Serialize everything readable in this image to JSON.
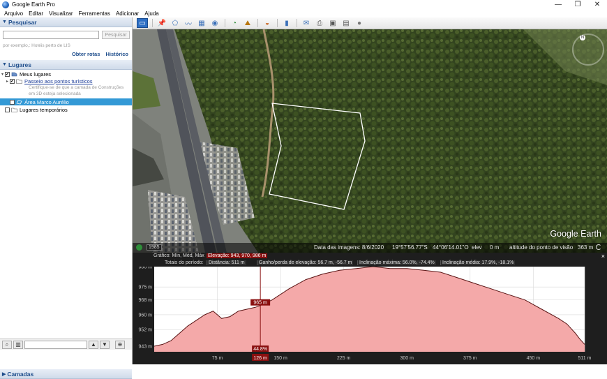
{
  "window": {
    "title": "Google Earth Pro",
    "controls": [
      "—",
      "❐",
      "✕"
    ]
  },
  "menu": [
    "Arquivo",
    "Editar",
    "Visualizar",
    "Ferramentas",
    "Adicionar",
    "Ajuda"
  ],
  "search": {
    "header": "Pesquisar",
    "placeholder": "",
    "button": "Pesquisar",
    "hint": "por exemplo,: Hotéis perto de LIS",
    "links": [
      "Obter rotas",
      "Histórico"
    ]
  },
  "places": {
    "header": "Lugares",
    "items": [
      {
        "label": "Meus lugares",
        "checked": true
      },
      {
        "label": "Passeio aos pontos turísticos",
        "checked": true
      },
      {
        "note_line1": "Certifique-se de que a camada de Construções",
        "note_line2": "em 3D esteja selecionada"
      },
      {
        "label": "Área Marco Aurélio",
        "checked": true
      },
      {
        "label": "Lugares temporários",
        "checked": false
      }
    ]
  },
  "layers": {
    "header": "Camadas"
  },
  "toolbar": {
    "icons": [
      "sidebar-toggle-icon",
      "placemark-icon",
      "polygon-icon",
      "path-icon",
      "overlay-icon",
      "record-tour-icon",
      "historical-imagery-icon",
      "sunlight-icon",
      "planets-icon",
      "ruler-icon",
      "email-icon",
      "print-icon",
      "save-image-icon",
      "maps-icon",
      "earth-icon"
    ]
  },
  "map": {
    "year": "1985",
    "logo": "Google Earth",
    "status": {
      "imagery_date": "Data das imagens: 8/6/2020",
      "latitude": "19°57'56.77\"S",
      "longitude": "44°06'14.01\"O",
      "elev_label": "elev",
      "elev_value": "0 m",
      "eye_alt_label": "altitude do ponto de visão",
      "eye_alt_value": "363 m"
    }
  },
  "elevation_profile": {
    "line1": {
      "graph_label": "Gráfico: Mín, Méd, Máx",
      "elevation": "Elevação: 943, 970, 986 m"
    },
    "line2": {
      "totals_label": "Totais do período:",
      "distance": "Distância: 511 m",
      "gain_loss": "Ganho/perda de elevação: 56.7 m, -56.7 m",
      "max_slope": "Inclinação máxima: 56.0%, -74.4%",
      "avg_slope": "Inclinação média: 17.9%, -18.1%"
    },
    "close": "×",
    "cursor_label": "965 m",
    "cursor_slope": "44.8%",
    "cursor_distance": "126 m",
    "colors": {
      "fill": "#f4a9a9",
      "line": "#5a1515",
      "bg": "#ffffff",
      "panel": "#1e1e1e"
    }
  },
  "chart_data": {
    "type": "area",
    "title": "",
    "xlabel": "",
    "ylabel": "",
    "x_ticks": [
      "75 m",
      "150 m",
      "225 m",
      "300 m",
      "375 m",
      "450 m",
      "511 m"
    ],
    "y_ticks": [
      "986 m",
      "975 m",
      "968 m",
      "960 m",
      "952 m",
      "943 m"
    ],
    "xlim": [
      0,
      511
    ],
    "ylim": [
      940,
      986
    ],
    "x": [
      0,
      10,
      20,
      30,
      40,
      50,
      60,
      70,
      75,
      80,
      90,
      100,
      110,
      120,
      126,
      140,
      160,
      180,
      200,
      220,
      240,
      260,
      280,
      300,
      320,
      340,
      360,
      380,
      400,
      420,
      440,
      460,
      480,
      490,
      500,
      505,
      511
    ],
    "y": [
      943,
      944,
      946,
      950,
      954,
      957,
      960,
      962,
      960,
      958,
      959,
      962,
      963,
      964,
      965,
      968,
      974,
      979,
      982,
      984,
      985,
      986,
      985,
      985,
      984,
      983,
      980,
      977,
      974,
      971,
      968,
      963,
      958,
      955,
      950,
      947,
      944
    ],
    "grid": true,
    "colors": {
      "fill": "#f4a9a9",
      "line": "#5a1515"
    }
  }
}
